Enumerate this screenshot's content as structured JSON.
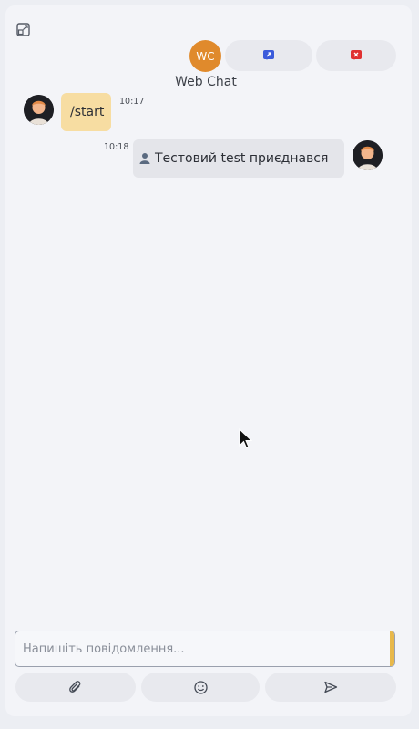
{
  "header": {
    "expand_icon": "expand-window-icon",
    "avatar_initials": "WC",
    "avatar_color": "#e08a2c",
    "chat_name": "Web Chat",
    "transfer_icon": "transfer-chat-icon",
    "transfer_color": "#3b5bdb",
    "close_icon": "close-chat-icon",
    "close_color": "#e03131"
  },
  "messages": [
    {
      "sender": "user",
      "text": "/start",
      "time": "10:17"
    },
    {
      "sender": "system",
      "icon": "user-icon",
      "text": "Тестовий test приєднався",
      "time": "10:18"
    }
  ],
  "composer": {
    "placeholder": "Напишіть повідомлення...",
    "value": "",
    "accent_color": "#e8b84a",
    "attach_icon": "paperclip-icon",
    "emoji_icon": "emoji-icon",
    "send_icon": "send-icon"
  }
}
